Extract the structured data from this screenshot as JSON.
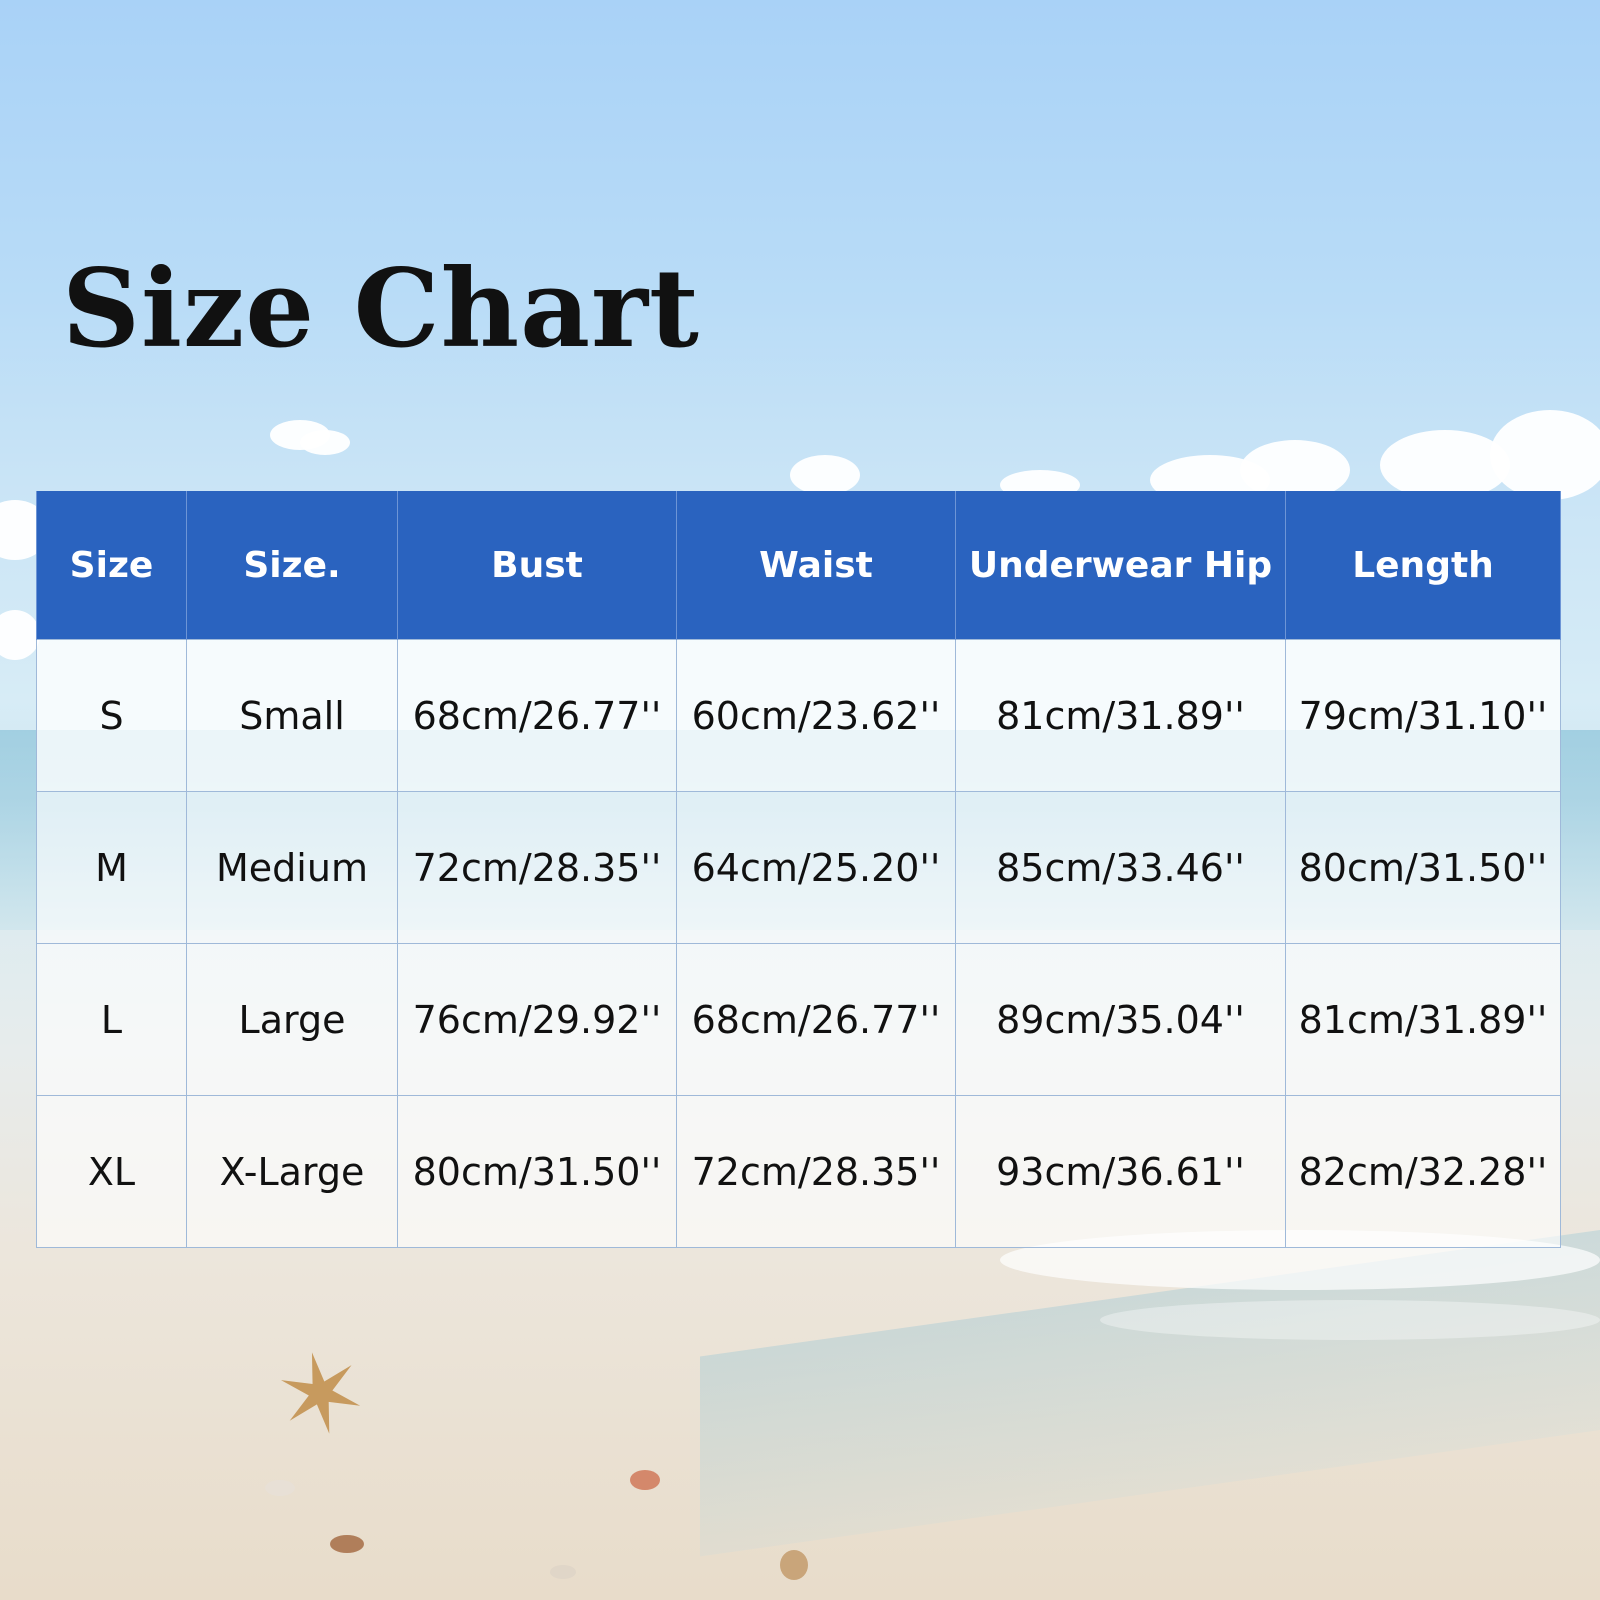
{
  "title": "Size Chart",
  "table": {
    "headers": [
      "Size",
      "Size.",
      "Bust",
      "Waist",
      "Underwear Hip",
      "Length"
    ],
    "rows": [
      [
        "S",
        "Small",
        "68cm/26.77''",
        "60cm/23.62''",
        "81cm/31.89''",
        "79cm/31.10''"
      ],
      [
        "M",
        "Medium",
        "72cm/28.35''",
        "64cm/25.20''",
        "85cm/33.46''",
        "80cm/31.50''"
      ],
      [
        "L",
        "Large",
        "76cm/29.92''",
        "68cm/26.77''",
        "89cm/35.04''",
        "81cm/31.89''"
      ],
      [
        "XL",
        "X-Large",
        "80cm/31.50''",
        "72cm/28.35''",
        "93cm/36.61''",
        "82cm/32.28''"
      ]
    ]
  },
  "colors": {
    "header_background": "#2a63bf",
    "header_text": "#ffffff",
    "cell_text": "#111111",
    "grid_line": "#9fb9d9"
  }
}
